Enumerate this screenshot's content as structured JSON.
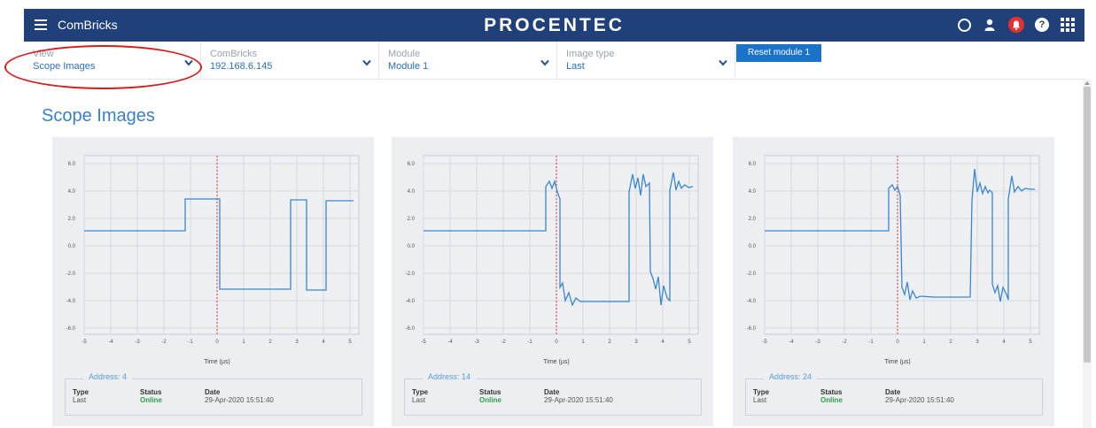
{
  "header": {
    "app_title": "ComBricks",
    "brand": "PROCENTEC",
    "icons": [
      "status-ring-icon",
      "user-icon",
      "bell-icon",
      "help-icon",
      "apps-grid-icon"
    ]
  },
  "filters": {
    "view": {
      "label": "View",
      "value": "Scope Images"
    },
    "combricks": {
      "label": "ComBricks",
      "value": "192.168.6.145"
    },
    "module": {
      "label": "Module",
      "value": "Module 1"
    },
    "image_type": {
      "label": "Image type",
      "value": "Last"
    },
    "reset_label": "Reset module 1"
  },
  "page_title": "Scope Images",
  "axis": {
    "x_label": "Time (µs)",
    "x_ticks": [
      "-5",
      "-4",
      "-3",
      "-2",
      "-1",
      "0",
      "1",
      "2",
      "3",
      "4",
      "5"
    ],
    "y_ticks": [
      "6.0",
      "4.0",
      "2.0",
      "0.0",
      "-2.0",
      "-4.0",
      "-6.0"
    ]
  },
  "info_headers": {
    "type": "Type",
    "status": "Status",
    "date": "Date"
  },
  "cards": [
    {
      "address": "Address: 4",
      "type": "Last",
      "status": "Online",
      "date": "29-Apr-2020 15:51:40"
    },
    {
      "address": "Address: 14",
      "type": "Last",
      "status": "Online",
      "date": "29-Apr-2020 15:51:40"
    },
    {
      "address": "Address: 24",
      "type": "Last",
      "status": "Online",
      "date": "29-Apr-2020 15:51:40"
    }
  ],
  "colors": {
    "header_bg": "#20407a",
    "accent": "#1a73c8",
    "trace": "#3a87d0",
    "trigger": "#e03a3a",
    "online": "#2ea043"
  }
}
